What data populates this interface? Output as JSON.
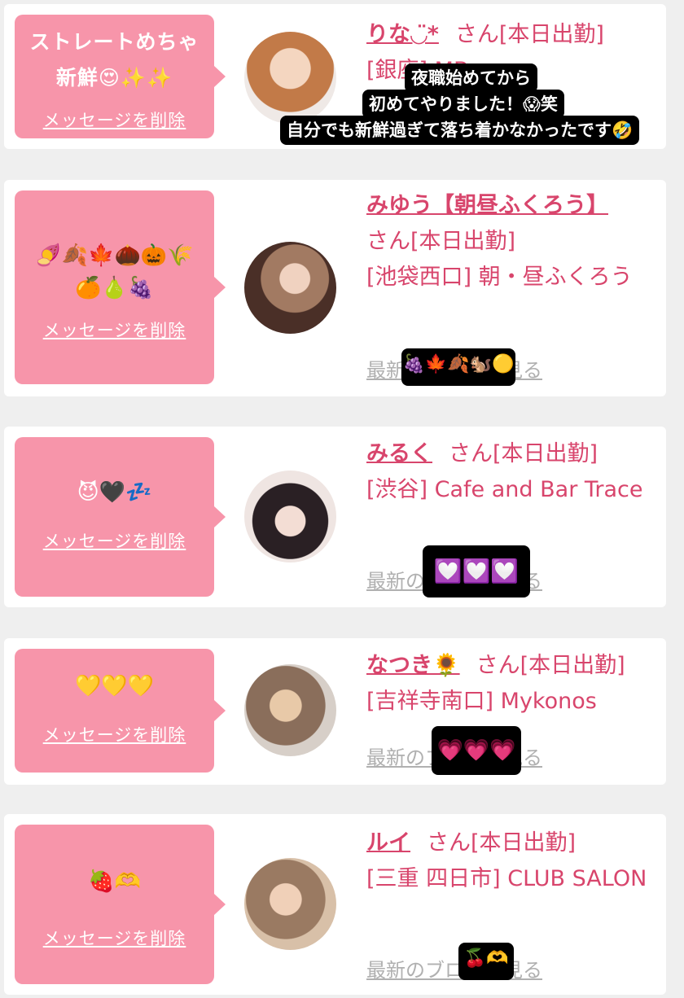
{
  "delete_label": "メッセージを削除",
  "blog_label": "最新のブログを見る",
  "suffix": "さん[本日出勤]",
  "cards": [
    {
      "message": "ストレートめちゃ新鮮😍✨✨",
      "name": "りな◡̈*",
      "shop": "[銀座] MB",
      "sticker": "",
      "avatar_colors": [
        "#f0c9a8",
        "#b4653a"
      ]
    },
    {
      "message": "🍠🍂🍁🌰🎃🌾🍊🍐🍇",
      "name": "みゆう【朝昼ふくろう】",
      "shop": "[池袋西口] 朝・昼ふくろう",
      "sticker": "🍇🍁🍂🐿️🟡",
      "avatar_colors": [
        "#4a2f27",
        "#a27a62"
      ]
    },
    {
      "message": "😈🖤💤",
      "name": "みるく",
      "shop": "[渋谷] Cafe and Bar Trace",
      "sticker": "💟💟💟",
      "avatar_colors": [
        "#efe5e2",
        "#2a2024"
      ]
    },
    {
      "message": "💛💛💛",
      "name": "なつき🌻",
      "shop": "[吉祥寺南口] Mykonos",
      "sticker": "💗💗💗",
      "avatar_colors": [
        "#d7cfc8",
        "#8a6e5b"
      ]
    },
    {
      "message": "🍓🫶",
      "name": "ルイ",
      "shop": "[三重 四日市] CLUB SALON",
      "sticker": "🍒🫶",
      "avatar_colors": [
        "#d8c0a8",
        "#9a7a62"
      ]
    }
  ],
  "overlay_caption": [
    "夜職始めてから",
    "初めてやりました！😱笑",
    "自分でも新鮮過ぎて落ち着かなかったです🤣"
  ]
}
